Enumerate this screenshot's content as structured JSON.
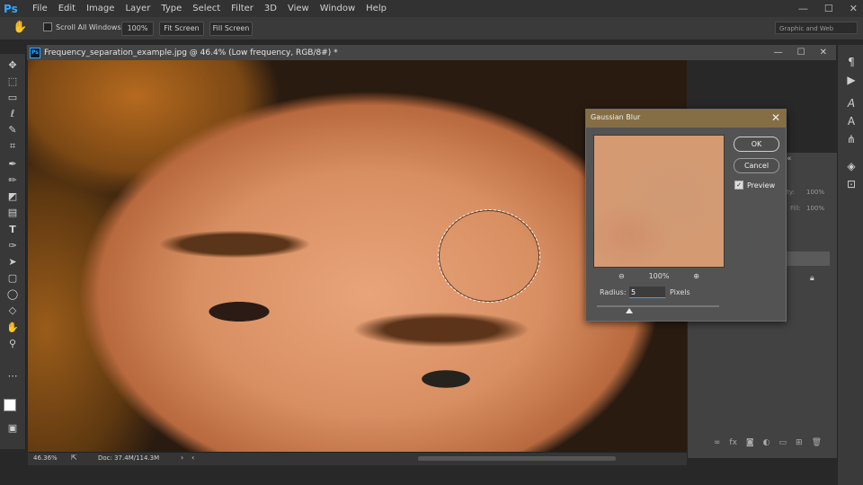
{
  "menubar": {
    "logo": "Ps",
    "items": [
      "File",
      "Edit",
      "Image",
      "Layer",
      "Type",
      "Select",
      "Filter",
      "3D",
      "View",
      "Window",
      "Help"
    ]
  },
  "options": {
    "scroll_all_label": "Scroll All Windows",
    "zoom_100": "100%",
    "fit_screen": "Fit Screen",
    "fill_screen": "Fill Screen",
    "workspace": "Graphic and Web"
  },
  "document": {
    "tab_title": "Frequency_separation_example.jpg @ 46.4% (Low frequency, RGB/8#) *"
  },
  "status": {
    "zoom": "46.36%",
    "doc_info": "Doc: 37.4M/114.3M"
  },
  "dialog": {
    "title": "Gaussian Blur",
    "ok_label": "OK",
    "cancel_label": "Cancel",
    "preview_label": "Preview",
    "preview_checked": true,
    "zoom_percent": "100%",
    "radius_label": "Radius:",
    "radius_value": "5",
    "radius_unit": "Pixels"
  },
  "layers": {
    "opacity_label": "acity:",
    "opacity_value": "100%",
    "fill_label": "Fill:",
    "fill_value": "100%"
  },
  "icons": {
    "close": "✕",
    "minimize": "—",
    "maximize": "☐"
  }
}
